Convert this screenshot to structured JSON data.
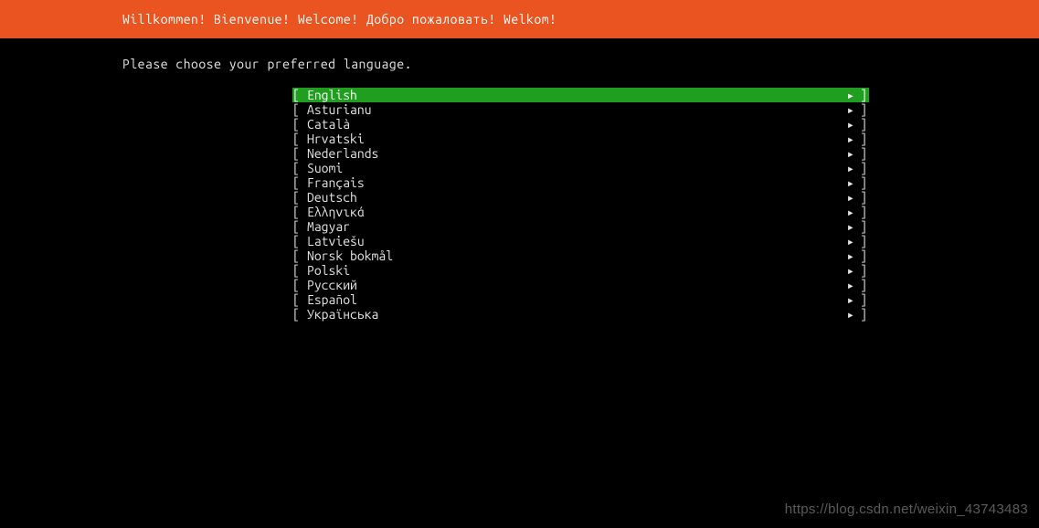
{
  "header": {
    "title": "Willkommen! Bienvenue! Welcome! Добро пожаловать! Welkom!"
  },
  "prompt": "Please choose your preferred language.",
  "brackets": {
    "open": "[",
    "close": "]"
  },
  "arrow": "▸",
  "languages": [
    {
      "label": "English",
      "selected": true
    },
    {
      "label": "Asturianu",
      "selected": false
    },
    {
      "label": "Català",
      "selected": false
    },
    {
      "label": "Hrvatski",
      "selected": false
    },
    {
      "label": "Nederlands",
      "selected": false
    },
    {
      "label": "Suomi",
      "selected": false
    },
    {
      "label": "Français",
      "selected": false
    },
    {
      "label": "Deutsch",
      "selected": false
    },
    {
      "label": "Ελληνικά",
      "selected": false
    },
    {
      "label": "Magyar",
      "selected": false
    },
    {
      "label": "Latviešu",
      "selected": false
    },
    {
      "label": "Norsk bokmål",
      "selected": false
    },
    {
      "label": "Polski",
      "selected": false
    },
    {
      "label": "Русский",
      "selected": false
    },
    {
      "label": "Español",
      "selected": false
    },
    {
      "label": "Українська",
      "selected": false
    }
  ],
  "watermark": "https://blog.csdn.net/weixin_43743483"
}
